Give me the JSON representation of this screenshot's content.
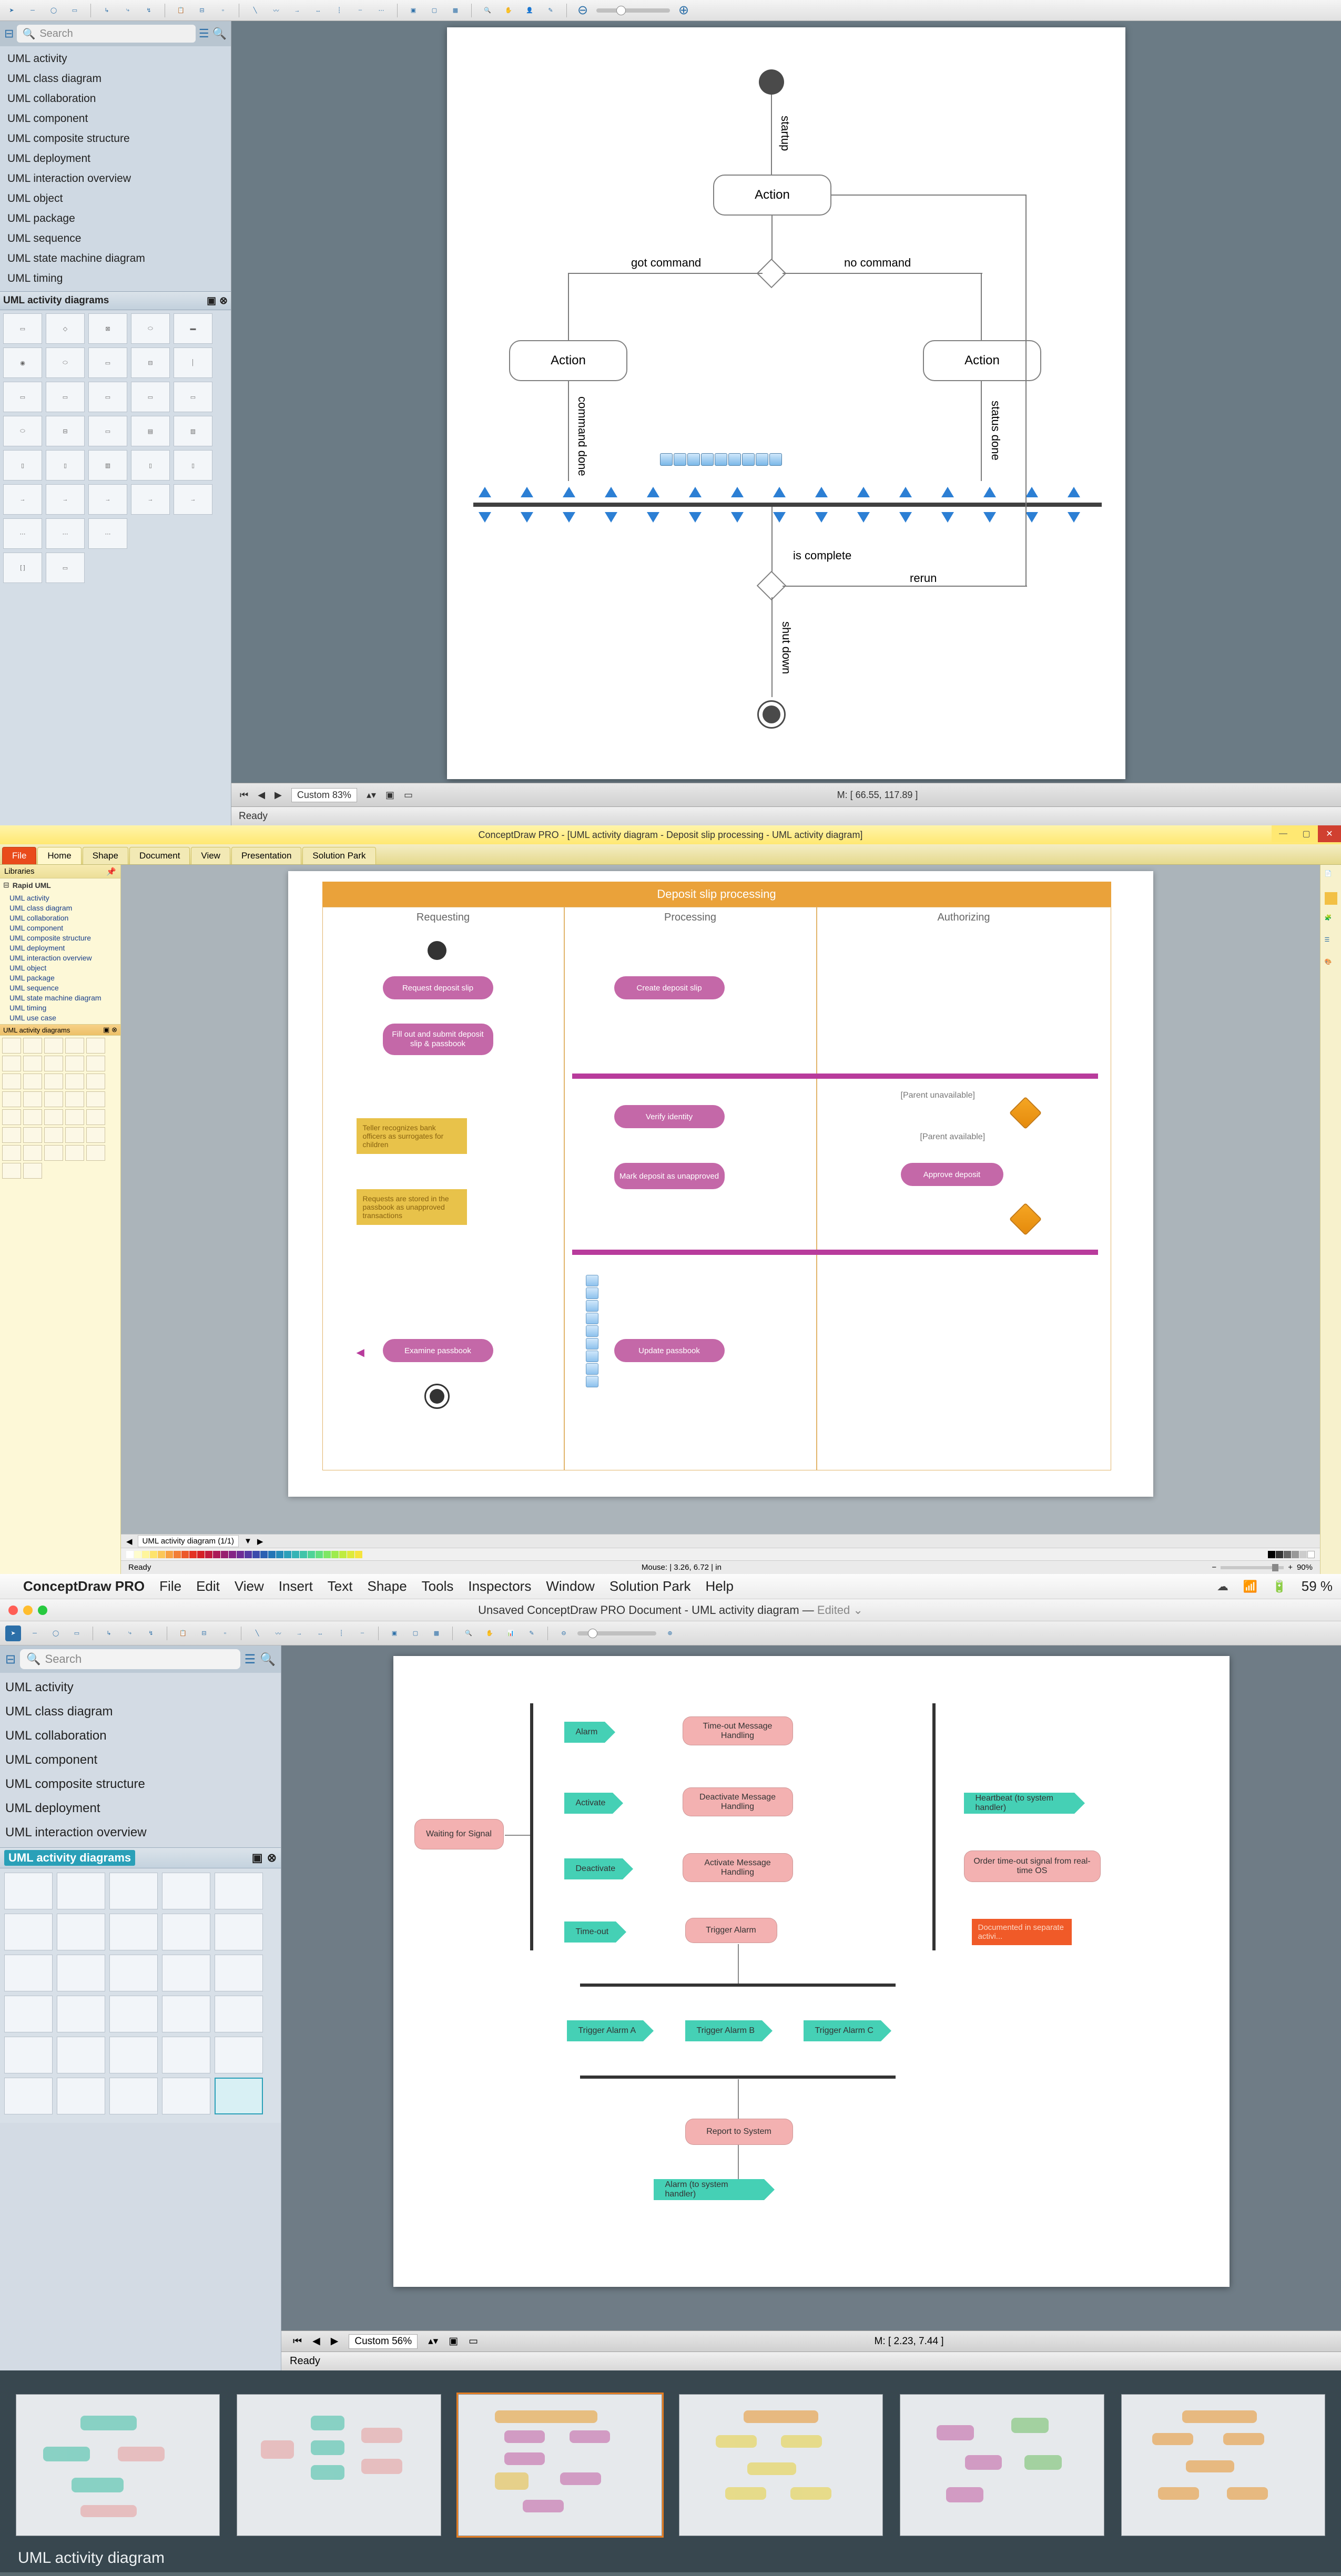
{
  "app1": {
    "search_placeholder": "Search",
    "libraries": [
      "UML activity",
      "UML class diagram",
      "UML collaboration",
      "UML component",
      "UML composite structure",
      "UML deployment",
      "UML interaction overview",
      "UML object",
      "UML package",
      "UML sequence",
      "UML state machine diagram",
      "UML timing"
    ],
    "stencil_panel_title": "UML activity diagrams",
    "zoom_label": "Custom 83%",
    "mouse": "M: [ 66.55, 117.89 ]",
    "status": "Ready",
    "diagram": {
      "action1": "Action",
      "action2": "Action",
      "action3": "Action",
      "startup": "startup",
      "got_command": "got command",
      "no_command": "no command",
      "command_done": "command done",
      "status_done": "status done",
      "is_complete": "is complete",
      "rerun": "rerun",
      "shut_down": "shut down"
    }
  },
  "app2": {
    "title": "ConceptDraw PRO - [UML activity diagram - Deposit slip processing - UML activity diagram]",
    "ribbon": [
      "File",
      "Home",
      "Shape",
      "Document",
      "View",
      "Presentation",
      "Solution Park"
    ],
    "left_panel_title": "Libraries",
    "rapid_uml": "Rapid UML",
    "libraries": [
      "UML activity",
      "UML class diagram",
      "UML collaboration",
      "UML component",
      "UML composite structure",
      "UML deployment",
      "UML interaction overview",
      "UML object",
      "UML package",
      "UML sequence",
      "UML state machine diagram",
      "UML timing",
      "UML use case"
    ],
    "stencil_panel_title": "UML activity diagrams",
    "tab": "UML activity diagram (1/1)",
    "mouse": "Mouse: | 3.26, 6.72 | in",
    "zoom": "90%",
    "status": "Ready",
    "diagram": {
      "title": "Deposit slip processing",
      "lanes": [
        "Requesting",
        "Processing",
        "Authorizing"
      ],
      "request_deposit": "Request deposit slip",
      "create_deposit": "Create deposit slip",
      "fill_out": "Fill out and submit deposit slip & passbook",
      "verify": "Verify identity",
      "mark_unapproved": "Mark deposit as unapproved",
      "approve": "Approve deposit",
      "examine": "Examine passbook",
      "update": "Update passbook",
      "note1": "Teller recognizes bank officers as surrogates for children",
      "note2": "Requests are stored in the passbook as unapproved transactions",
      "guard_unavail": "[Parent unavailable]",
      "guard_avail": "[Parent available]"
    }
  },
  "app3": {
    "menubar": [
      "File",
      "Edit",
      "View",
      "Insert",
      "Text",
      "Shape",
      "Tools",
      "Inspectors",
      "Window",
      "Solution Park",
      "Help"
    ],
    "app_name": "ConceptDraw PRO",
    "battery": "59 %",
    "title": "Unsaved ConceptDraw PRO Document - UML activity diagram",
    "title_suffix": "Edited",
    "search_placeholder": "Search",
    "libraries": [
      "UML activity",
      "UML class diagram",
      "UML collaboration",
      "UML component",
      "UML composite structure",
      "UML deployment",
      "UML interaction overview"
    ],
    "stencil_panel_title": "UML activity diagrams",
    "zoom_label": "Custom 56%",
    "mouse": "M: [ 2.23, 7.44 ]",
    "status": "Ready",
    "diagram": {
      "waiting": "Waiting for Signal",
      "alarm": "Alarm",
      "activate": "Activate",
      "deactivate": "Deactivate",
      "timeout": "Time-out",
      "timeout_msg": "Time-out Message Handling",
      "deact_msg": "Deactivate Message Handling",
      "act_msg": "Activate Message Handling",
      "trigger_alarm": "Trigger Alarm",
      "heartbeat": "Heartbeat (to system handler)",
      "order_timeout": "Order time-out signal from real-time OS",
      "doc_note": "Documented in separate activi...",
      "tr_a": "Trigger Alarm A",
      "tr_b": "Trigger Alarm B",
      "tr_c": "Trigger Alarm C",
      "report": "Report to System",
      "alarm_handler": "Alarm (to system handler)"
    }
  },
  "gallery": {
    "caption": "UML activity diagram"
  }
}
